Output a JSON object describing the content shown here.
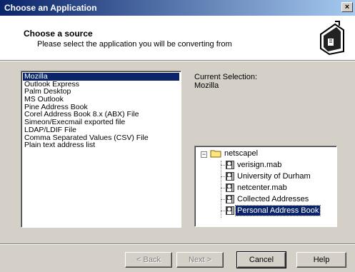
{
  "window": {
    "title": "Choose an Application",
    "close_label": "×"
  },
  "header": {
    "heading": "Choose a source",
    "subheading": "Please select the application you will be converting from",
    "icon": "address-book-icon"
  },
  "applications": [
    "Mozilla",
    "Outlook Express",
    "Palm Desktop",
    "MS Outlook",
    "Pine Address Book",
    "Corel Address Book 8.x (ABX) File",
    "Simeon/Execmail exported file",
    "LDAP/LDIF File",
    "Comma Separated Values (CSV) File",
    "Plain text address list"
  ],
  "selection": {
    "label": "Current Selection:",
    "value": "Mozilla"
  },
  "tree": {
    "root": "netscapel",
    "expander": "−",
    "children": [
      "verisign.mab",
      "University of Durham",
      "netcenter.mab",
      "Collected Addresses",
      "Personal Address Book"
    ]
  },
  "buttons": {
    "back": "< Back",
    "next": "Next >",
    "cancel": "Cancel",
    "help": "Help"
  },
  "colors": {
    "selection": "#0a246a",
    "face": "#d4d0c8"
  }
}
